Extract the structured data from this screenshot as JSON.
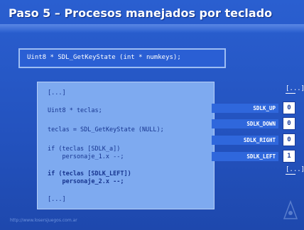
{
  "slide": {
    "title": "Paso 5 – Procesos manejados por teclado",
    "declaration": "Uint8 * SDL_GetKeyState (int * numkeys);",
    "code_lines": [
      "[...]",
      "Uint8 * teclas;",
      "teclas = SDL_GetKeyState (NULL);",
      "if (teclas [SDLK_a])",
      "    personaje_1.x --;",
      "if (teclas [SDLK_LEFT])",
      "    personaje_2.x --;",
      "[...]"
    ],
    "bracket_top": "[...]",
    "bracket_bottom": "[...]",
    "keys": [
      {
        "label": "SDLK_UP",
        "value": "0"
      },
      {
        "label": "SDLK_DOWN",
        "value": "0"
      },
      {
        "label": "SDLK_RIGHT",
        "value": "0"
      },
      {
        "label": "SDLK_LEFT",
        "value": "1"
      }
    ],
    "footer": "http://www.losersjuegos.com.ar"
  }
}
